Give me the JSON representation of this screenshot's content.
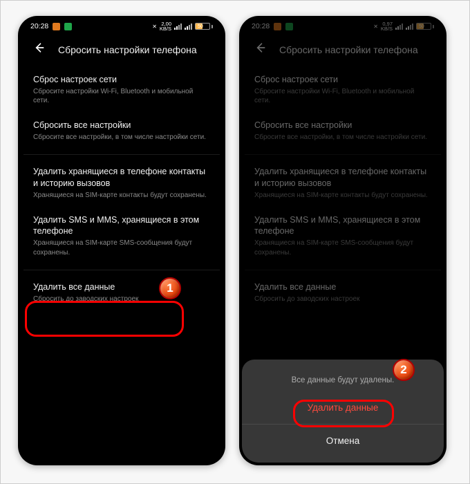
{
  "status": {
    "time_left": "20:28",
    "time_right": "20:28",
    "speed_left": "2,00\nKB/S",
    "speed_right": "0,97\nKB/S",
    "battery_pct": "50"
  },
  "header": {
    "title": "Сбросить настройки телефона"
  },
  "items": [
    {
      "title": "Сброс настроек сети",
      "sub": "Сбросите настройки Wi-Fi, Bluetooth и мобильной сети."
    },
    {
      "title": "Сбросить все настройки",
      "sub": "Сбросите все настройки, в том числе настройки сети."
    },
    {
      "title": "Удалить хранящиеся в телефоне контакты и историю вызовов",
      "sub": "Хранящиеся на SIM-карте контакты будут сохранены."
    },
    {
      "title": "Удалить SMS и MMS, хранящиеся в этом телефоне",
      "sub": "Хранящиеся на SIM-карте SMS-сообщения будут сохранены."
    },
    {
      "title": "Удалить все данные",
      "sub": "Сбросить до заводских настроек"
    }
  ],
  "sheet": {
    "message": "Все данные будут удалены.",
    "confirm": "Удалить данные",
    "cancel": "Отмена"
  },
  "badges": {
    "one": "1",
    "two": "2"
  }
}
